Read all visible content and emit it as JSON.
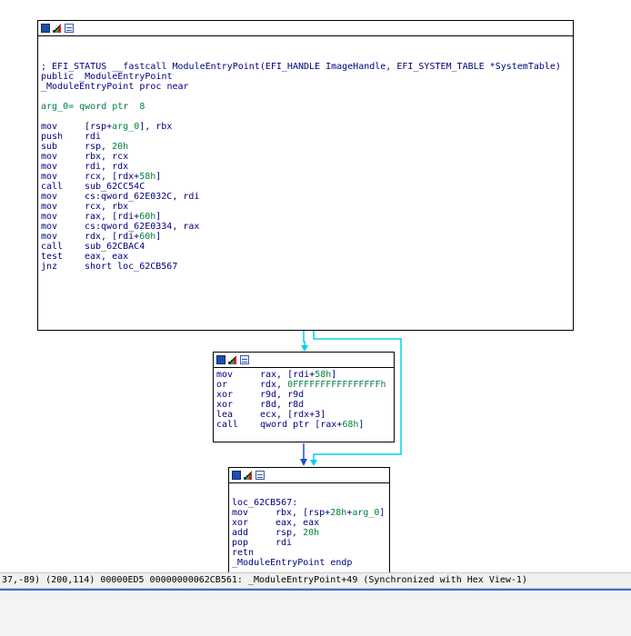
{
  "node1": {
    "comment": "; EFI_STATUS __fastcall ModuleEntryPoint(EFI_HANDLE ImageHandle, EFI_SYSTEM_TABLE *SystemTable)",
    "public_line": "public _ModuleEntryPoint",
    "proc_line": "_ModuleEntryPoint proc near",
    "arg_line": "arg_0= qword ptr  8",
    "instructions": [
      {
        "m": "mov",
        "o": "[rsp+arg_0], rbx"
      },
      {
        "m": "push",
        "o": "rdi"
      },
      {
        "m": "sub",
        "o": "rsp, 20h"
      },
      {
        "m": "mov",
        "o": "rbx, rcx"
      },
      {
        "m": "mov",
        "o": "rdi, rdx"
      },
      {
        "m": "mov",
        "o": "rcx, [rdx+58h]"
      },
      {
        "m": "call",
        "o": "sub_62CC54C"
      },
      {
        "m": "mov",
        "o": "cs:qword_62E032C, rdi"
      },
      {
        "m": "mov",
        "o": "rcx, rbx"
      },
      {
        "m": "mov",
        "o": "rax, [rdi+60h]"
      },
      {
        "m": "mov",
        "o": "cs:qword_62E0334, rax"
      },
      {
        "m": "mov",
        "o": "rdx, [rdi+60h]"
      },
      {
        "m": "call",
        "o": "sub_62CBAC4"
      },
      {
        "m": "test",
        "o": "eax, eax"
      },
      {
        "m": "jnz",
        "o": "short loc_62CB567"
      }
    ]
  },
  "node2": {
    "instructions": [
      {
        "m": "mov",
        "o": "rax, [rdi+58h]"
      },
      {
        "m": "or",
        "o": "rdx, 0FFFFFFFFFFFFFFFFh"
      },
      {
        "m": "xor",
        "o": "r9d, r9d"
      },
      {
        "m": "xor",
        "o": "r8d, r8d"
      },
      {
        "m": "lea",
        "o": "ecx, [rdx+3]"
      },
      {
        "m": "call",
        "o": "qword ptr [rax+68h]"
      }
    ]
  },
  "node3": {
    "label": "loc_62CB567:",
    "instructions": [
      {
        "m": "mov",
        "o": "rbx, [rsp+28h+arg_0]"
      },
      {
        "m": "xor",
        "o": "eax, eax"
      },
      {
        "m": "add",
        "o": "rsp, 20h"
      },
      {
        "m": "pop",
        "o": "rdi"
      },
      {
        "m": "retn",
        "o": ""
      }
    ],
    "endp_line": "_ModuleEntryPoint endp"
  },
  "status_bar": {
    "text": "37,-89) (200,114) 00000ED5 00000000062CB561: _ModuleEntryPoint+49 (Synchronized with Hex View-1)"
  },
  "colors": {
    "edge_true": "#00d0f0",
    "edge_false": "#00d0f0",
    "edge_flow": "#1b4fcf",
    "mnemonic": "#000080",
    "immediate": "#008040"
  },
  "icons": [
    "graph-node-icon",
    "edit-node-icon",
    "text-view-icon"
  ]
}
